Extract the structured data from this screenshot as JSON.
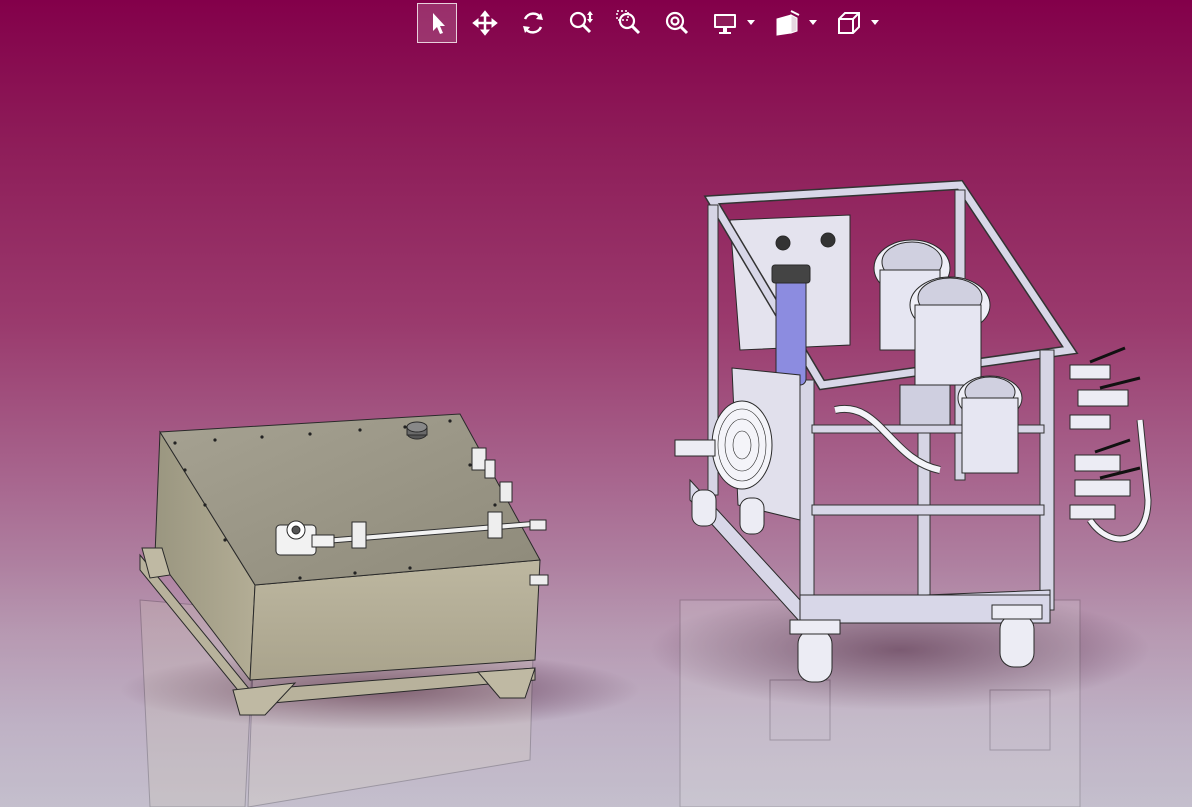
{
  "toolbar": {
    "buttons": [
      {
        "name": "select-icon",
        "active": true
      },
      {
        "name": "pan-icon",
        "active": false
      },
      {
        "name": "rotate-icon",
        "active": false
      },
      {
        "name": "zoom-icon",
        "active": false
      },
      {
        "name": "zoom-box-icon",
        "active": false
      },
      {
        "name": "zoom-fit-icon",
        "active": false
      }
    ],
    "dropdowns": [
      {
        "name": "display-mode-icon"
      },
      {
        "name": "render-style-icon"
      },
      {
        "name": "view-cube-icon"
      }
    ]
  },
  "scene": {
    "objects": [
      {
        "name": "hydraulic-tank"
      },
      {
        "name": "hydraulic-power-unit"
      }
    ],
    "colors": {
      "background_top": "#83004a",
      "background_bottom": "#bcb6c6",
      "tank_body": "#a8a48a",
      "frame": "#d8d6e6",
      "filter": "#8c8ce0"
    }
  }
}
